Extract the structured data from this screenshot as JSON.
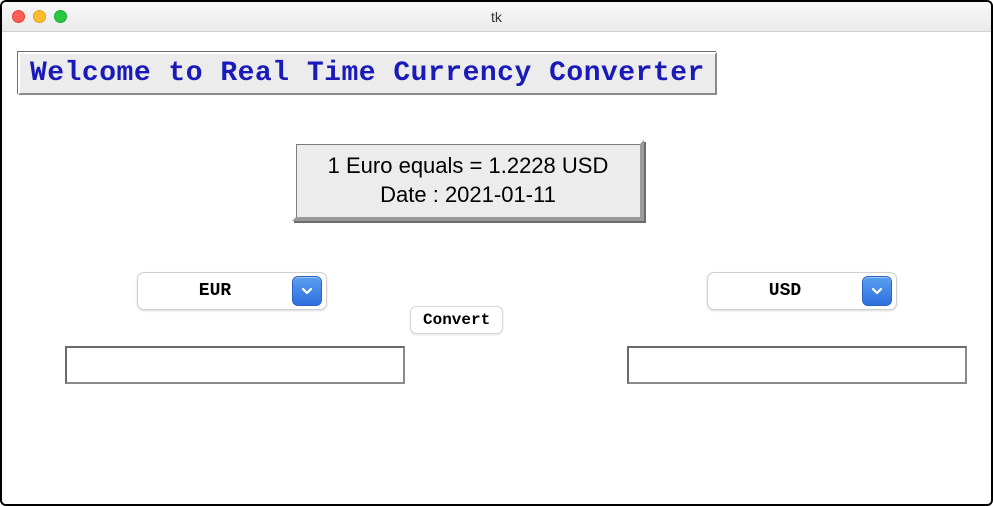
{
  "window": {
    "title": "tk"
  },
  "banner": {
    "text": "Welcome to Real Time Currency Converter"
  },
  "rate": {
    "line1": "1 Euro equals = 1.2228 USD",
    "line2": "Date : 2021-01-11"
  },
  "from": {
    "selected": "EUR",
    "value": ""
  },
  "to": {
    "selected": "USD",
    "value": ""
  },
  "actions": {
    "convert_label": "Convert"
  }
}
